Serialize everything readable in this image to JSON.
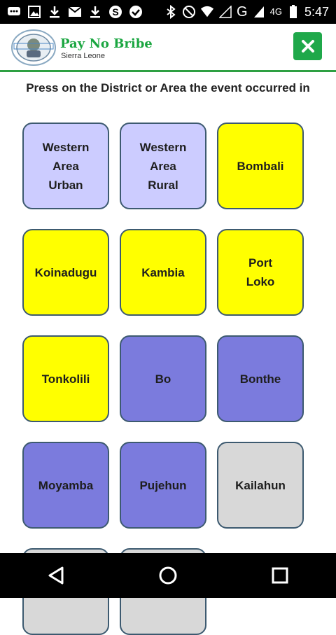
{
  "status_bar": {
    "time": "5:47",
    "network_label": "G",
    "lte_label": "4G",
    "left_icons": [
      "chat-icon",
      "image-icon",
      "download-icon",
      "mail-icon",
      "download-icon",
      "skype-icon",
      "check-icon"
    ],
    "right_icons": [
      "bluetooth-icon",
      "do-not-disturb-icon",
      "wifi-icon",
      "signal-icon",
      "signal-icon",
      "battery-icon"
    ]
  },
  "app_bar": {
    "title": "Pay No Bribe",
    "subtitle": "Sierra Leone",
    "close_icon": "close-icon"
  },
  "main": {
    "prompt": "Press on the District or Area the event occurred in",
    "districts": [
      {
        "label": "Western\nArea\nUrban",
        "color": "#ccccff"
      },
      {
        "label": "Western\nArea\nRural",
        "color": "#ccccff"
      },
      {
        "label": "Bombali",
        "color": "#ffff00"
      },
      {
        "label": "Koinadugu",
        "color": "#ffff00"
      },
      {
        "label": "Kambia",
        "color": "#ffff00"
      },
      {
        "label": "Port\nLoko",
        "color": "#ffff00"
      },
      {
        "label": "Tonkolili",
        "color": "#ffff00"
      },
      {
        "label": "Bo",
        "color": "#7b7bdd"
      },
      {
        "label": "Bonthe",
        "color": "#7b7bdd"
      },
      {
        "label": "Moyamba",
        "color": "#7b7bdd"
      },
      {
        "label": "Pujehun",
        "color": "#7b7bdd"
      },
      {
        "label": "Kailahun",
        "color": "#d8d8d8"
      }
    ]
  },
  "nav_bar": {
    "back_icon": "back-triangle-icon",
    "home_icon": "home-circle-icon",
    "recents_icon": "recents-square-icon"
  }
}
